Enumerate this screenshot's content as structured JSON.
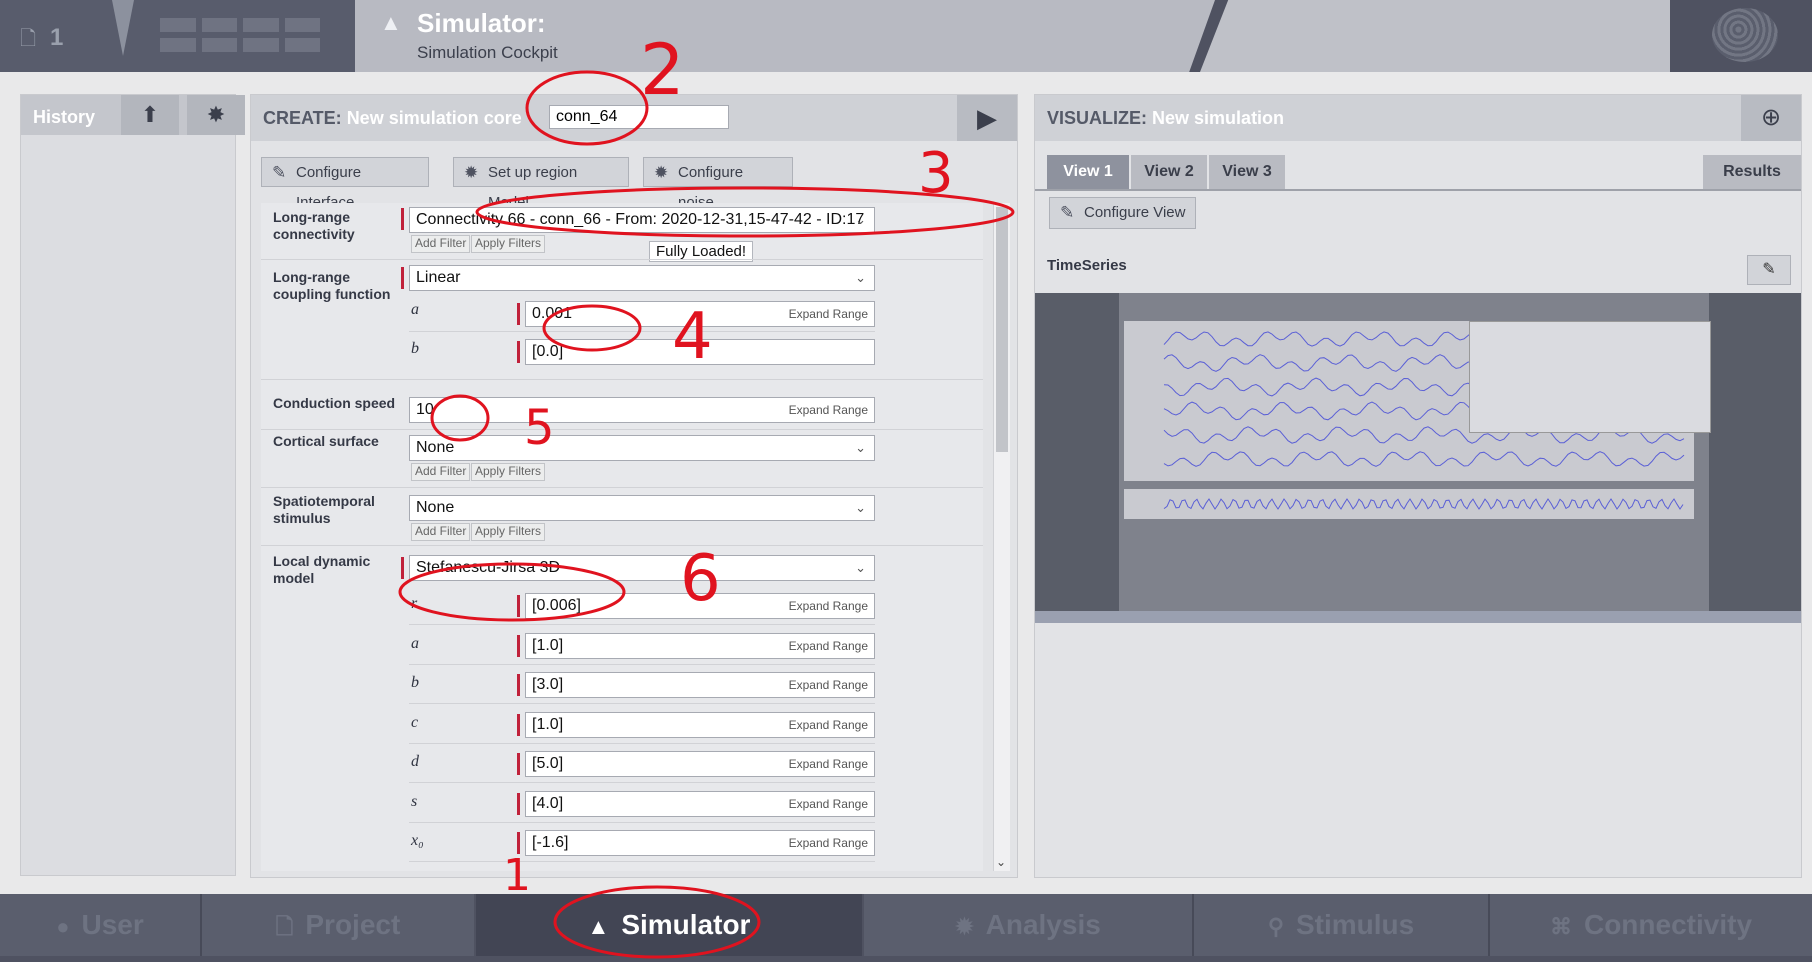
{
  "topbar": {
    "project_count": "1",
    "title": "Simulator:",
    "subtitle": "Simulation Cockpit"
  },
  "history": {
    "title": "History"
  },
  "create": {
    "title_prefix": "CREATE:",
    "title_text": "New simulation core",
    "name_value": "conn_64",
    "toolbar": {
      "configure_interface": "Configure Interface",
      "region_model": "Set up region Model",
      "configure_noise": "Configure noise"
    },
    "fields": {
      "connectivity_label_1": "Long-range",
      "connectivity_label_2": "connectivity",
      "connectivity_value": "Connectivity 66 - conn_66 - From: 2020-12-31,15-47-42 - ID:17",
      "tooltip": "Fully Loaded!",
      "add_filter": "Add Filter",
      "apply_filters": "Apply Filters",
      "coupling_label_1": "Long-range",
      "coupling_label_2": "coupling function",
      "coupling_value": "Linear",
      "coupling_a_name": "a",
      "coupling_a_value": "0.001",
      "coupling_b_name": "b",
      "coupling_b_value": "[0.0]",
      "conduction_label": "Conduction speed",
      "conduction_value": "10",
      "cortical_label": "Cortical surface",
      "cortical_value": "None",
      "stimulus_label_1": "Spatiotemporal",
      "stimulus_label_2": "stimulus",
      "stimulus_value": "None",
      "model_label_1": "Local dynamic",
      "model_label_2": "model",
      "model_value": "Stefanescu-Jirsa 3D",
      "expand_range": "Expand Range",
      "params": [
        {
          "name": "r",
          "value": "[0.006]"
        },
        {
          "name": "a",
          "value": "[1.0]"
        },
        {
          "name": "b",
          "value": "[3.0]"
        },
        {
          "name": "c",
          "value": "[1.0]"
        },
        {
          "name": "d",
          "value": "[5.0]"
        },
        {
          "name": "s",
          "value": "[4.0]"
        },
        {
          "name": "x₀",
          "value": "[-1.6]"
        }
      ]
    }
  },
  "visualize": {
    "title_prefix": "VISUALIZE:",
    "title_text": "New simulation",
    "tabs": [
      "View 1",
      "View 2",
      "View 3"
    ],
    "results_tab": "Results",
    "configure_view": "Configure View",
    "timeseries_label": "TimeSeries"
  },
  "bottom_nav": {
    "user": "User",
    "project": "Project",
    "simulator": "Simulator",
    "analysis": "Analysis",
    "stimulus": "Stimulus",
    "connectivity": "Connectivity"
  },
  "annotations": [
    "1",
    "2",
    "3",
    "4",
    "5",
    "6"
  ],
  "colors": {
    "accent_required": "#c0213a",
    "annotation_red": "#e0131f",
    "nav_bg": "#4f5261"
  }
}
